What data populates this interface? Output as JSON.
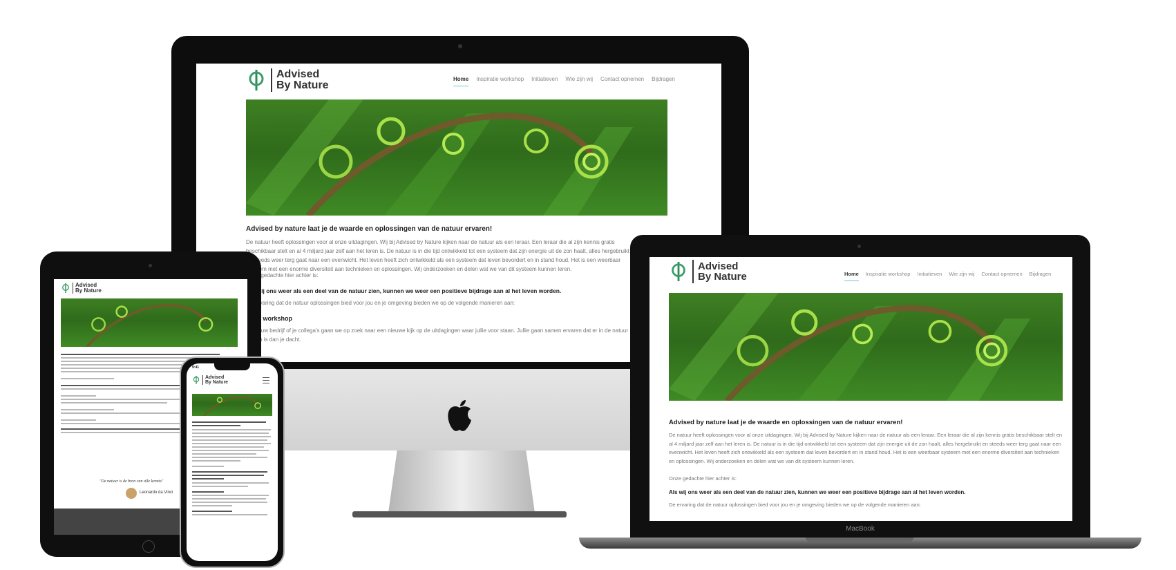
{
  "site": {
    "logo_line1": "Advised",
    "logo_line2": "By Nature",
    "nav": [
      "Home",
      "Inspiratie workshop",
      "Initiatieven",
      "Wie zijn wij",
      "Contact opnemen",
      "Bijdragen"
    ],
    "heading": "Advised by nature laat je de waarde en oplossingen van de natuur ervaren!",
    "intro": "De natuur heeft oplossingen voor al onze uitdagingen. Wij bij Advised by Nature kijken naar de natuur als een leraar. Een leraar die al zijn kennis gratis beschikbaar stelt en al 4 miljard jaar zelf aan het leren is. De natuur is in die tijd ontwikkeld tot een systeem dat zijn energie uit de zon haalt, alles hergebruikt en steeds weer terg gaat naar een evenwicht. Het leven heeft zich ontwikkeld als een systeem dat leven bevordert en in stand houd. Het is een weerbaar systeem met een enorme diversiteit aan technieken en oplossingen. Wij onderzoeken en delen wat we van dit systeem kunnen leren.",
    "thought": "Onze gedachte hier achter is:",
    "statement": "Als wij ons weer als een deel van de natuur zien, kunnen we weer een positieve bijdrage aan al het leven worden.",
    "experience": "De ervaring dat de natuur oplossingen bied voor jou en je omgeving bieden we op de volgende manieren aan:",
    "workshop_title": "Onze workshop",
    "workshop_text": "Met jouw bedrijf of je collega's gaan we op zoek naar een nieuwe kijk op de uitdagingen waar jullie voor staan. Jullie gaan samen ervaren dat er in de natuur te zien is dan je dacht."
  },
  "laptop": {
    "brand_label": "MacBook"
  },
  "tablet": {
    "quote": "\"De natuur is de bron van alle kennis\"",
    "author": "Leonardo da Vinci"
  },
  "phone": {
    "time": "9:41"
  },
  "colors": {
    "accent": "#6cc3d9",
    "logo_green": "#3a9c6a",
    "device_dark": "#111111",
    "imac_silver": "#d9d9d9"
  }
}
